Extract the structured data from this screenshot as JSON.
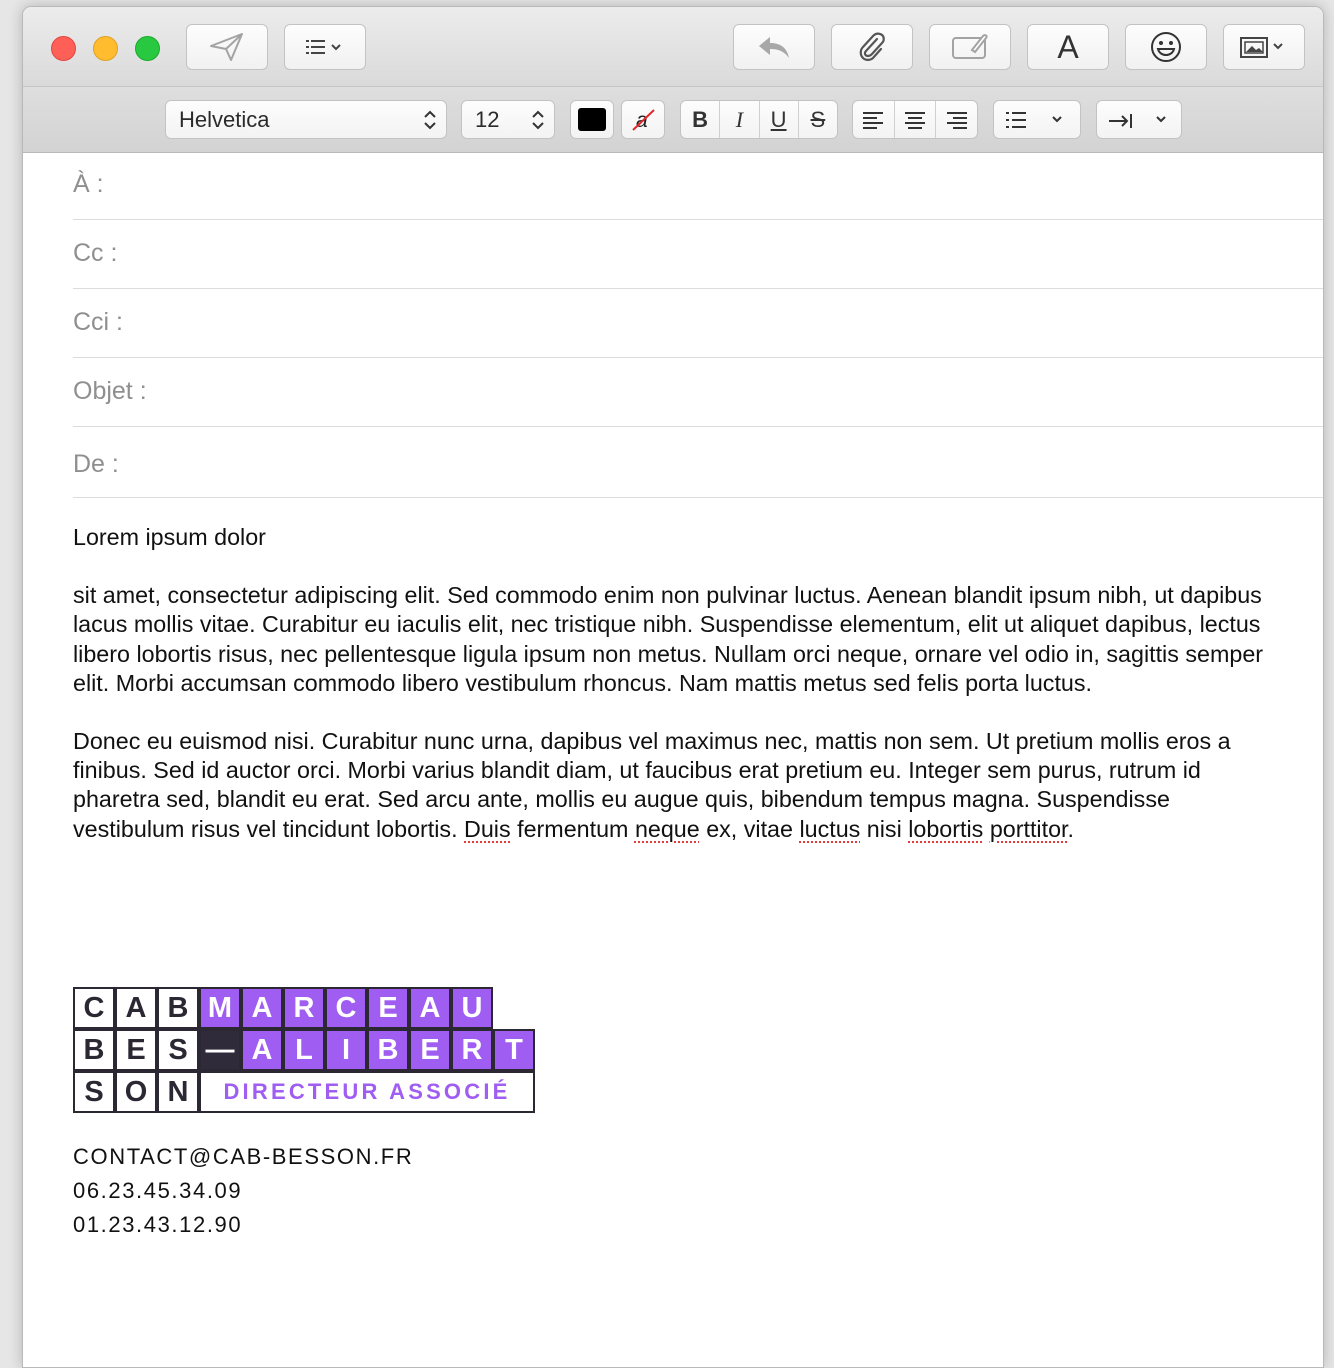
{
  "toolbar": {
    "send_icon": "paper-plane-icon",
    "header_fields_icon": "list-icon",
    "reply_icon": "reply-arrow-icon",
    "attach_icon": "paperclip-icon",
    "markup_icon": "markup-icon",
    "format_label": "A",
    "emoji_icon": "smiley-icon",
    "photo_icon": "photo-browser-icon"
  },
  "format": {
    "font": "Helvetica",
    "size": "12",
    "text_color": "#000000",
    "bold": "B",
    "italic": "I",
    "underline": "U",
    "strike": "S"
  },
  "headers": {
    "to": "À :",
    "cc": "Cc :",
    "bcc": "Cci :",
    "subject": "Objet :",
    "from": "De :"
  },
  "message": {
    "greeting": "Lorem ipsum dolor",
    "paragraph1": "sit amet, consectetur adipiscing elit. Sed commodo enim non pulvinar luctus. Aenean blandit ipsum nibh, ut dapibus lacus mollis vitae. Curabitur eu iaculis elit, nec tristique nibh. Suspendisse elementum, elit ut aliquet dapibus, lectus libero lobortis risus, nec pellentesque ligula ipsum non metus. Nullam orci neque, ornare vel odio in, sagittis semper elit. Morbi accumsan commodo libero vestibulum rhoncus. Nam mattis metus sed felis porta luctus.",
    "paragraph2_plain": "Donec eu euismod nisi. Curabitur nunc urna, dapibus vel maximus nec, mattis non sem. Ut pretium mollis eros a finibus. Sed id auctor orci. Morbi varius blandit diam, ut faucibus erat pretium eu. Integer sem purus, rutrum id pharetra sed, blandit eu erat. Sed arcu ante, mollis eu augue quis, bibendum tempus magna. Suspendisse vestibulum risus vel tincidunt lobortis. ",
    "w_duis": "Duis",
    "w_fermentum": " fermentum ",
    "w_neque": "neque",
    "w_ex": " ex, vitae ",
    "w_luctus": "luctus",
    "w_nisi": " nisi ",
    "w_lobortis": "lobortis",
    "w_space": " ",
    "w_porttitor": "porttitor",
    "w_period": "."
  },
  "signature": {
    "logo_row1": [
      "C",
      "A",
      "B",
      "M",
      "A",
      "R",
      "C",
      "E",
      "A",
      "U"
    ],
    "logo_row2": [
      "B",
      "E",
      "S",
      "—",
      "A",
      "L",
      "I",
      "B",
      "E",
      "R",
      "T"
    ],
    "logo_row3": [
      "S",
      "O",
      "N"
    ],
    "role": "DIRECTEUR ASSOCIÉ",
    "accent_color": "#9f5df1",
    "dark_color": "#2b2833",
    "email": "CONTACT@CAB-BESSON.FR",
    "phone1": "06.23.45.34.09",
    "phone2": "01.23.43.12.90"
  }
}
